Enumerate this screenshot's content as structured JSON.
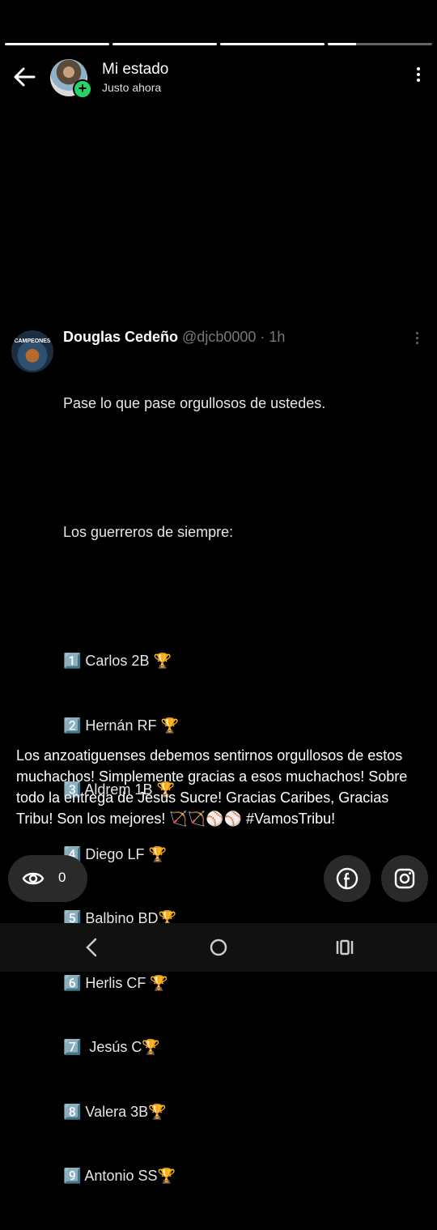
{
  "status": {
    "title": "Mi estado",
    "subtitle": "Justo ahora",
    "progress_segments": [
      1,
      1,
      1,
      0.27
    ]
  },
  "tweet": {
    "author_name": "Douglas Cedeño",
    "handle": "@djcb0000",
    "time": "· 1h",
    "avatar_text": "CAMPEONES",
    "lines": [
      "Pase lo que pase orgullosos de ustedes.",
      "",
      "Los guerreros de siempre:",
      "",
      "1️⃣ Carlos 2B 🏆",
      "2️⃣ Hernán RF 🏆",
      "3️⃣ Aldrem 1B 🏆",
      "4️⃣ Diego LF 🏆",
      "5️⃣ Balbino BD🏆",
      "6️⃣ Herlis CF 🏆",
      "7️⃣  Jesús C🏆",
      "8️⃣ Valera 3B🏆",
      "9️⃣ Antonio SS🏆"
    ]
  },
  "caption": "Los anzoatiguenses debemos sentirnos orgullosos de estos muchachos! Simplemente gracias a esos muchachos! Sobre todo la entrega de Jesús Sucre! Gracias Caribes, Gracias Tribu! Son los mejores! 🏹🏹⚾⚾ #VamosTribu!",
  "views": {
    "count": "0",
    "icon": "eye-icon"
  },
  "share": [
    {
      "icon": "facebook-icon"
    },
    {
      "icon": "instagram-icon"
    }
  ],
  "navbar": [
    {
      "icon": "back-nav-icon"
    },
    {
      "icon": "home-nav-icon"
    },
    {
      "icon": "recents-nav-icon"
    }
  ]
}
